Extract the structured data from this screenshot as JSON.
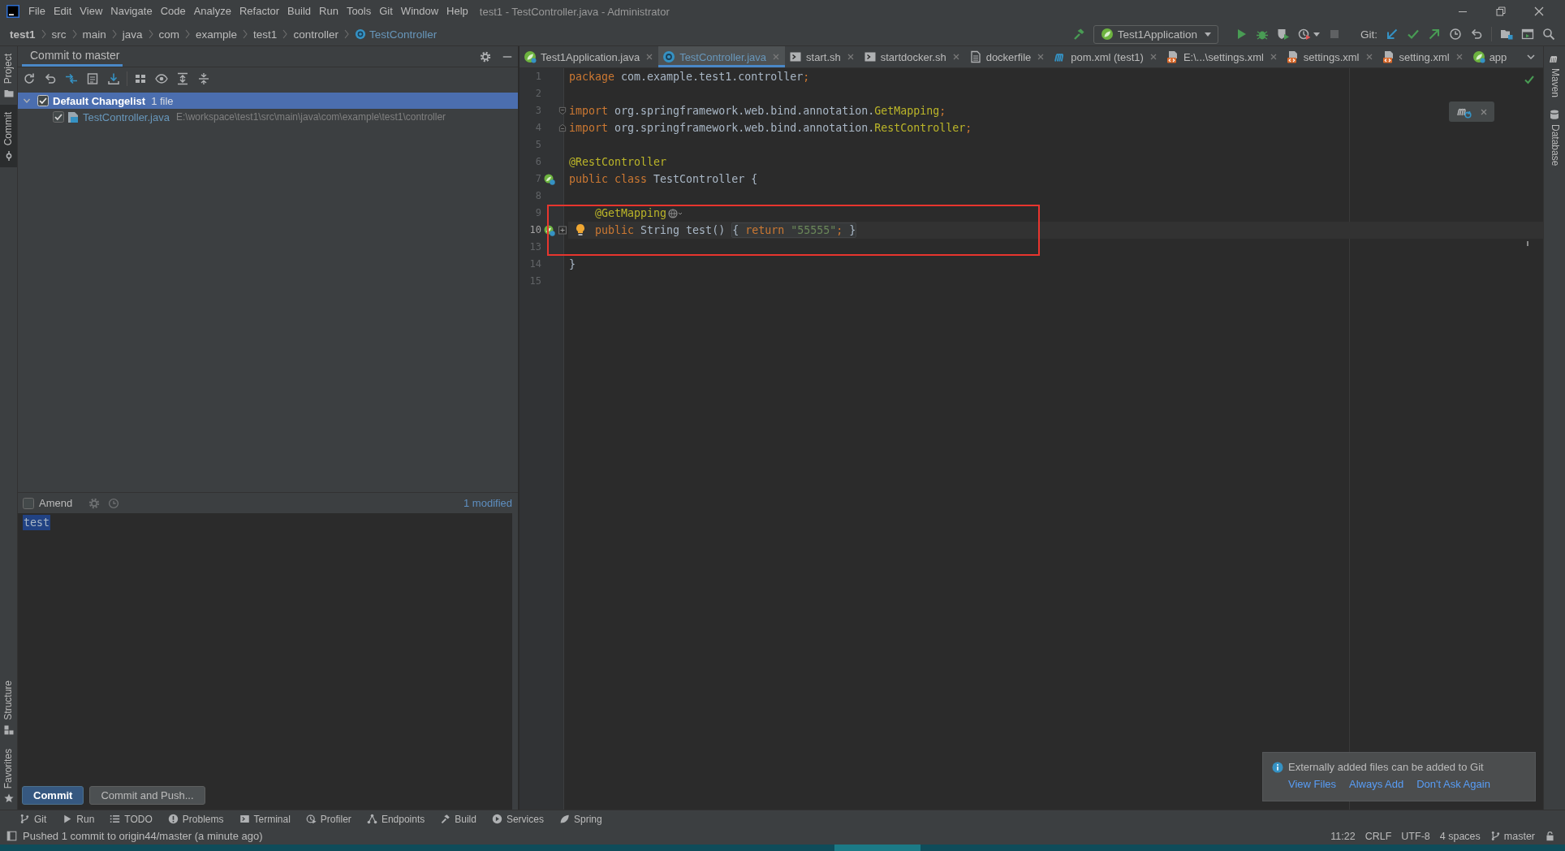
{
  "window": {
    "title": "test1 - TestController.java - Administrator"
  },
  "menu": [
    "File",
    "Edit",
    "View",
    "Navigate",
    "Code",
    "Analyze",
    "Refactor",
    "Build",
    "Run",
    "Tools",
    "Git",
    "Window",
    "Help"
  ],
  "breadcrumbs": [
    {
      "label": "test1",
      "kind": "project",
      "modified": false
    },
    {
      "label": "src",
      "kind": "folder",
      "modified": false
    },
    {
      "label": "main",
      "kind": "folder",
      "modified": false
    },
    {
      "label": "java",
      "kind": "folder",
      "modified": false
    },
    {
      "label": "com",
      "kind": "folder",
      "modified": false
    },
    {
      "label": "example",
      "kind": "folder",
      "modified": false
    },
    {
      "label": "test1",
      "kind": "folder",
      "modified": false
    },
    {
      "label": "controller",
      "kind": "folder",
      "modified": false
    },
    {
      "label": "TestController",
      "kind": "class",
      "modified": true
    }
  ],
  "toolbar": {
    "run_configuration": "Test1Application",
    "git_label": "Git:"
  },
  "left_stripe": {
    "top": [
      {
        "label": "Project",
        "kind": "project",
        "selected": false
      },
      {
        "label": "Commit",
        "kind": "commit",
        "selected": true
      }
    ],
    "bottom": [
      {
        "label": "Structure",
        "kind": "structure",
        "selected": false
      },
      {
        "label": "Favorites",
        "kind": "favorites",
        "selected": false
      }
    ]
  },
  "commit_panel": {
    "title": "Commit to master",
    "changelist": {
      "name": "Default Changelist",
      "count": "1 file",
      "checked": true,
      "expanded": true,
      "selected": true,
      "files": [
        {
          "name": "TestController.java",
          "path": "E:\\workspace\\test1\\src\\main\\java\\com\\example\\test1\\controller",
          "checked": true,
          "modified": true
        }
      ]
    },
    "amend": {
      "label": "Amend",
      "checked": false
    },
    "modified": "1 modified",
    "message": {
      "value": "test",
      "text_selected": true
    },
    "buttons": [
      {
        "label": "Commit",
        "kind": "primary"
      },
      {
        "label": "Commit and Push...",
        "kind": "secondary"
      }
    ]
  },
  "editor": {
    "tabs": [
      {
        "label": "Test1Application.java",
        "kind": "app",
        "selected": false,
        "modified": false,
        "closable": true
      },
      {
        "label": "TestController.java",
        "kind": "class",
        "selected": true,
        "modified": true,
        "closable": true
      },
      {
        "label": "start.sh",
        "kind": "shell",
        "selected": false,
        "modified": false,
        "closable": true
      },
      {
        "label": "startdocker.sh",
        "kind": "shell",
        "selected": false,
        "modified": false,
        "closable": true
      },
      {
        "label": "dockerfile",
        "kind": "text",
        "selected": false,
        "modified": false,
        "closable": true
      },
      {
        "label": "pom.xml (test1)",
        "kind": "maven",
        "selected": false,
        "modified": false,
        "closable": true
      },
      {
        "label": "E:\\...\\settings.xml",
        "kind": "xml",
        "selected": false,
        "modified": false,
        "closable": true
      },
      {
        "label": "settings.xml",
        "kind": "xml",
        "selected": false,
        "modified": false,
        "closable": true
      },
      {
        "label": "setting.xml",
        "kind": "xml",
        "selected": false,
        "modified": false,
        "closable": true
      },
      {
        "label": "app",
        "kind": "app",
        "selected": false,
        "modified": false,
        "closable": false
      }
    ],
    "lines": [
      {
        "number": "1",
        "current": false,
        "marked": false,
        "segments": [
          {
            "text": "package",
            "kind": "keyword"
          },
          {
            "text": " com.example.test1.controller",
            "kind": "plain"
          },
          {
            "text": ";",
            "kind": "keyword"
          }
        ]
      },
      {
        "number": "2",
        "current": false,
        "marked": false
      },
      {
        "number": "3",
        "current": false,
        "marked": false,
        "fold_start": true,
        "segments": [
          {
            "text": "import",
            "kind": "keyword"
          },
          {
            "text": " org.springframework.web.bind.annotation.",
            "kind": "plain"
          },
          {
            "text": "GetMapping",
            "kind": "annotation"
          },
          {
            "text": ";",
            "kind": "keyword"
          }
        ]
      },
      {
        "number": "4",
        "current": false,
        "marked": false,
        "fold_end": true,
        "segments": [
          {
            "text": "import",
            "kind": "keyword"
          },
          {
            "text": " org.springframework.web.bind.annotation.",
            "kind": "plain"
          },
          {
            "text": "RestController",
            "kind": "annotation"
          },
          {
            "text": ";",
            "kind": "keyword"
          }
        ]
      },
      {
        "number": "5",
        "current": false,
        "marked": false
      },
      {
        "number": "6",
        "current": false,
        "marked": false,
        "segments": [
          {
            "text": "@RestController",
            "kind": "annotation"
          }
        ]
      },
      {
        "number": "7",
        "current": false,
        "marked": false,
        "bean_icon": true,
        "segments": [
          {
            "text": "public class",
            "kind": "keyword"
          },
          {
            "text": " TestController {",
            "kind": "plain"
          }
        ],
        "children": [
          {
            "number": "8",
            "current": false,
            "marked": false
          },
          {
            "number": "9",
            "current": false,
            "marked": true,
            "endpoint_icon": true,
            "segments": [
              {
                "text": "@GetMapping",
                "kind": "annotation"
              }
            ]
          },
          {
            "number": "10",
            "current": true,
            "marked": true,
            "bulb": true,
            "bean_icon": true,
            "fold_collapsed": true,
            "segments": [
              {
                "text": "public",
                "kind": "keyword"
              },
              {
                "text": " String test() ",
                "kind": "plain"
              }
            ],
            "folded": [
              {
                "text": "{ ",
                "kind": "plain"
              },
              {
                "text": "return",
                "kind": "keyword"
              },
              {
                "text": " \"55555\"",
                "kind": "string"
              },
              {
                "text": ";",
                "kind": "keyword"
              },
              {
                "text": " }",
                "kind": "plain"
              }
            ]
          },
          {
            "number": "13",
            "current": false,
            "marked": true
          }
        ]
      },
      {
        "number": "14",
        "current": false,
        "marked": false,
        "segments": [
          {
            "text": "}",
            "kind": "plain"
          }
        ]
      },
      {
        "number": "15",
        "current": false,
        "marked": false
      }
    ]
  },
  "right_stripe": [
    {
      "label": "Maven",
      "kind": "maven"
    },
    {
      "label": "Database",
      "kind": "database"
    }
  ],
  "notification": {
    "message": "Externally added files can be added to Git",
    "links": [
      "View Files",
      "Always Add",
      "Don't Ask Again"
    ]
  },
  "tool_windows": [
    {
      "label": "Git",
      "kind": "git"
    },
    {
      "label": "Run",
      "kind": "run"
    },
    {
      "label": "TODO",
      "kind": "todo"
    },
    {
      "label": "Problems",
      "kind": "problems"
    },
    {
      "label": "Terminal",
      "kind": "terminal"
    },
    {
      "label": "Profiler",
      "kind": "profiler"
    },
    {
      "label": "Endpoints",
      "kind": "endpoints"
    },
    {
      "label": "Build",
      "kind": "build"
    },
    {
      "label": "Services",
      "kind": "services"
    },
    {
      "label": "Spring",
      "kind": "spring"
    }
  ],
  "status_bar": {
    "message": "Pushed 1 commit to origin44/master (a minute ago)",
    "caret": "11:22",
    "line_separator": "CRLF",
    "encoding": "UTF-8",
    "indent": "4 spaces",
    "branch": "master"
  }
}
